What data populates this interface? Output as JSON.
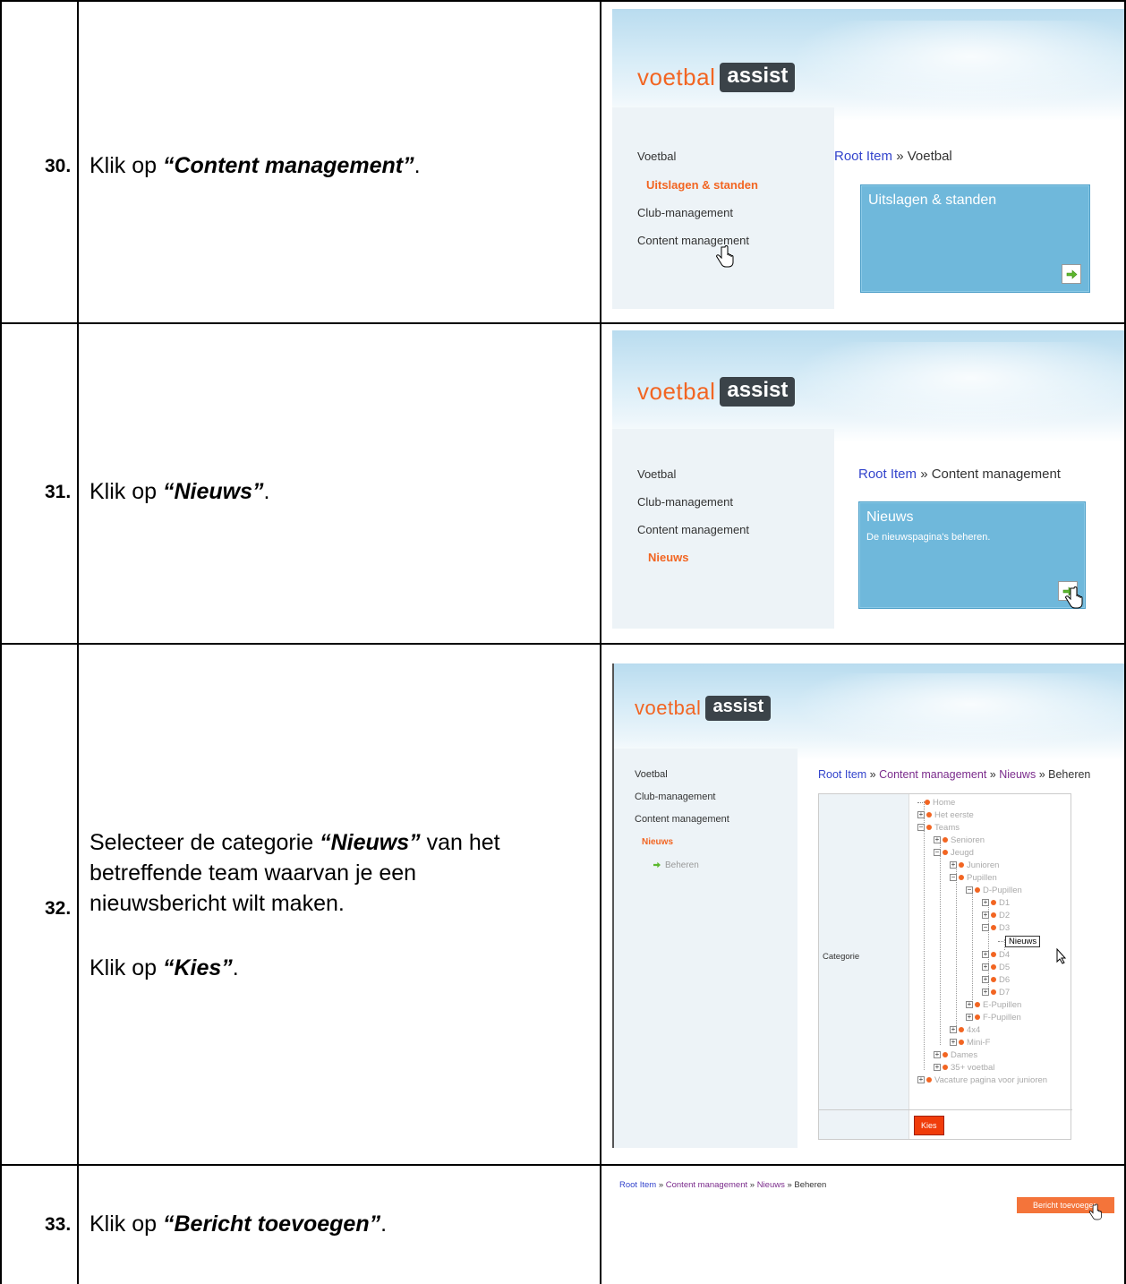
{
  "steps": [
    {
      "num": "30.",
      "line1_prefix": "Klik op ",
      "line1_emph": "“Content management”",
      "line1_suffix": "."
    },
    {
      "num": "31.",
      "line1_prefix": "Klik op ",
      "line1_emph": "“Nieuws”",
      "line1_suffix": "."
    },
    {
      "num": "32.",
      "para1_prefix": "Selecteer de categorie ",
      "para1_emph": "“Nieuws”",
      "para1_suffix": " van het",
      "para1_line2": "betreffende team waarvan je een",
      "para1_line3": "nieuwsbericht wilt maken.",
      "para2_prefix": "Klik op ",
      "para2_emph": "“Kies”",
      "para2_suffix": "."
    },
    {
      "num": "33.",
      "line1_prefix": "Klik op ",
      "line1_emph": "“Bericht toevoegen”",
      "line1_suffix": "."
    }
  ],
  "logo": {
    "voetbal": "voetbal",
    "assist": "assist"
  },
  "shot1": {
    "nav": [
      "Voetbal",
      "Uitslagen & standen",
      "Club-management",
      "Content management"
    ],
    "crumb_link": "Root Item",
    "crumb_sep": " » ",
    "crumb_current": "Voetbal",
    "box_title": "Uitslagen & standen"
  },
  "shot2": {
    "nav": [
      "Voetbal",
      "Club-management",
      "Content management",
      "Nieuws"
    ],
    "crumb_link": "Root Item",
    "crumb_sep": " » ",
    "crumb_current": "Content management",
    "box_title": "Nieuws",
    "box_sub": "De nieuwspagina's beheren."
  },
  "shot3": {
    "nav": [
      "Voetbal",
      "Club-management",
      "Content management",
      "Nieuws",
      "Beheren"
    ],
    "crumbs": [
      "Root Item",
      "Content management",
      "Nieuws",
      "Beheren"
    ],
    "crumb_sep": " » ",
    "category_label": "Categorie",
    "tree": [
      "Home",
      "Het eerste",
      "Teams",
      "Senioren",
      "Jeugd",
      "Junioren",
      "Pupillen",
      "D-Pupillen",
      "D1",
      "D2",
      "D3",
      "Nieuws",
      "D4",
      "D5",
      "D6",
      "D7",
      "E-Pupillen",
      "F-Pupillen",
      "4x4",
      "Mini-F",
      "Dames",
      "35+ voetbal",
      "Vacature pagina voor junioren"
    ],
    "kies": "Kies"
  },
  "shot4": {
    "crumbs": [
      "Root Item",
      "Content management",
      "Nieuws",
      "Beheren"
    ],
    "crumb_sep": " » ",
    "button": "Bericht toevoegen"
  },
  "colors": {
    "accent": "#f26522",
    "box_blue": "#6fb8db",
    "sidebar": "#edf3f7",
    "link": "#3344cc"
  }
}
